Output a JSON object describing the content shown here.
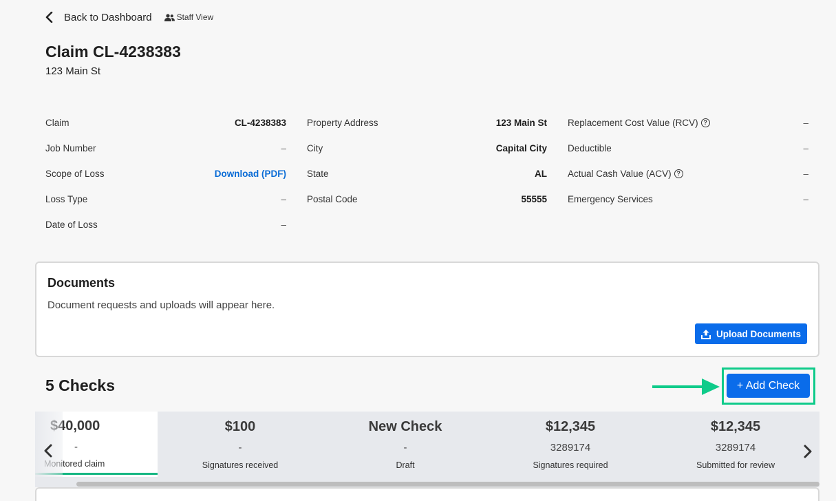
{
  "nav": {
    "back_label": "Back to Dashboard",
    "staff_label": "Staff View"
  },
  "claim": {
    "title": "Claim CL-4238383",
    "address": "123 Main St"
  },
  "details": {
    "col1": [
      {
        "label": "Claim",
        "value": "CL-4238383"
      },
      {
        "label": "Job Number",
        "value": "–"
      },
      {
        "label": "Scope of Loss",
        "value": "Download (PDF)"
      },
      {
        "label": "Loss Type",
        "value": "–"
      },
      {
        "label": "Date of Loss",
        "value": "–"
      }
    ],
    "col2": [
      {
        "label": "Property Address",
        "value": "123 Main St"
      },
      {
        "label": "City",
        "value": "Capital City"
      },
      {
        "label": "State",
        "value": "AL"
      },
      {
        "label": "Postal Code",
        "value": "55555"
      }
    ],
    "col3": [
      {
        "label": "Replacement Cost Value (RCV)",
        "value": "–"
      },
      {
        "label": "Deductible",
        "value": "–"
      },
      {
        "label": "Actual Cash Value (ACV)",
        "value": "–"
      },
      {
        "label": "Emergency Services",
        "value": "–"
      }
    ],
    "help_glyph": "?"
  },
  "documents": {
    "title": "Documents",
    "description": "Document requests and uploads will appear here.",
    "upload_label": "Upload Documents"
  },
  "checks": {
    "title": "5 Checks",
    "add_label": "+ Add Check",
    "tiles": [
      {
        "amount": "$40,000",
        "number": "-",
        "status": "Monitored claim"
      },
      {
        "amount": "$100",
        "number": "-",
        "status": "Signatures received"
      },
      {
        "amount": "New Check",
        "number": "-",
        "status": "Draft"
      },
      {
        "amount": "$12,345",
        "number": "3289174",
        "status": "Signatures required"
      },
      {
        "amount": "$12,345",
        "number": "3289174",
        "status": "Submitted for review"
      }
    ]
  },
  "colors": {
    "primary": "#0a6cea",
    "highlight": "#0fcb8a",
    "active_underline": "#16b682",
    "link": "#0a6cd6"
  }
}
